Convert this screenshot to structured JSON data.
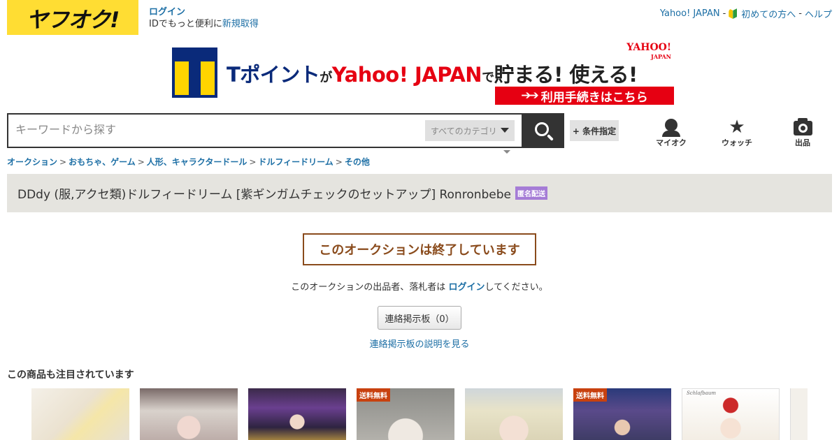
{
  "header": {
    "logo_text": "ヤフオク!",
    "login_label": "ログイン",
    "login_sub_prefix": "IDでもっと便利に",
    "signup_label": "新規取得",
    "toplinks": {
      "yahoo": "Yahoo! JAPAN",
      "sep": "-",
      "beginner": "初めての方へ",
      "help": "ヘルプ"
    }
  },
  "banner": {
    "part1": "Tポイント",
    "part2": "が",
    "part3": "Yahoo! JAPAN",
    "part4": "で",
    "part5": "貯まる! 使える!",
    "yahoo_mark": "YAHOO!",
    "yahoo_mark_sub": "JAPAN",
    "cta": "利用手続きはこちら",
    "cta_arrows": "➔➔"
  },
  "search": {
    "placeholder": "キーワードから探す",
    "category": "すべてのカテゴリ",
    "conditions_label": "+ 条件指定"
  },
  "nav_icons": [
    {
      "label": "マイオク",
      "icon": "person-icon"
    },
    {
      "label": "ウォッチ",
      "icon": "star-icon"
    },
    {
      "label": "出品",
      "icon": "camera-icon"
    }
  ],
  "breadcrumb": [
    "オークション",
    "おもちゃ、ゲーム",
    "人形、キャラクタードール",
    "ドルフィードリーム",
    "その他"
  ],
  "breadcrumb_sep": ">",
  "item": {
    "title": "DDdy (服,アクセ類)ドルフィードリーム [紫ギンガムチェックのセットアップ] Ronronbebe",
    "badge": "匿名配送"
  },
  "status": {
    "ended": "このオークションは終了しています",
    "notice_prefix": "このオークションの出品者、落札者は ",
    "notice_link": "ログイン",
    "notice_suffix": "してください。",
    "board_button": "連絡掲示板（0）",
    "board_link": "連絡掲示板の説明を見る"
  },
  "recommended": {
    "heading": "この商品も注目されています",
    "free_shipping_label": "送料無料",
    "thumb_brand_text": "Schlafbaum"
  }
}
